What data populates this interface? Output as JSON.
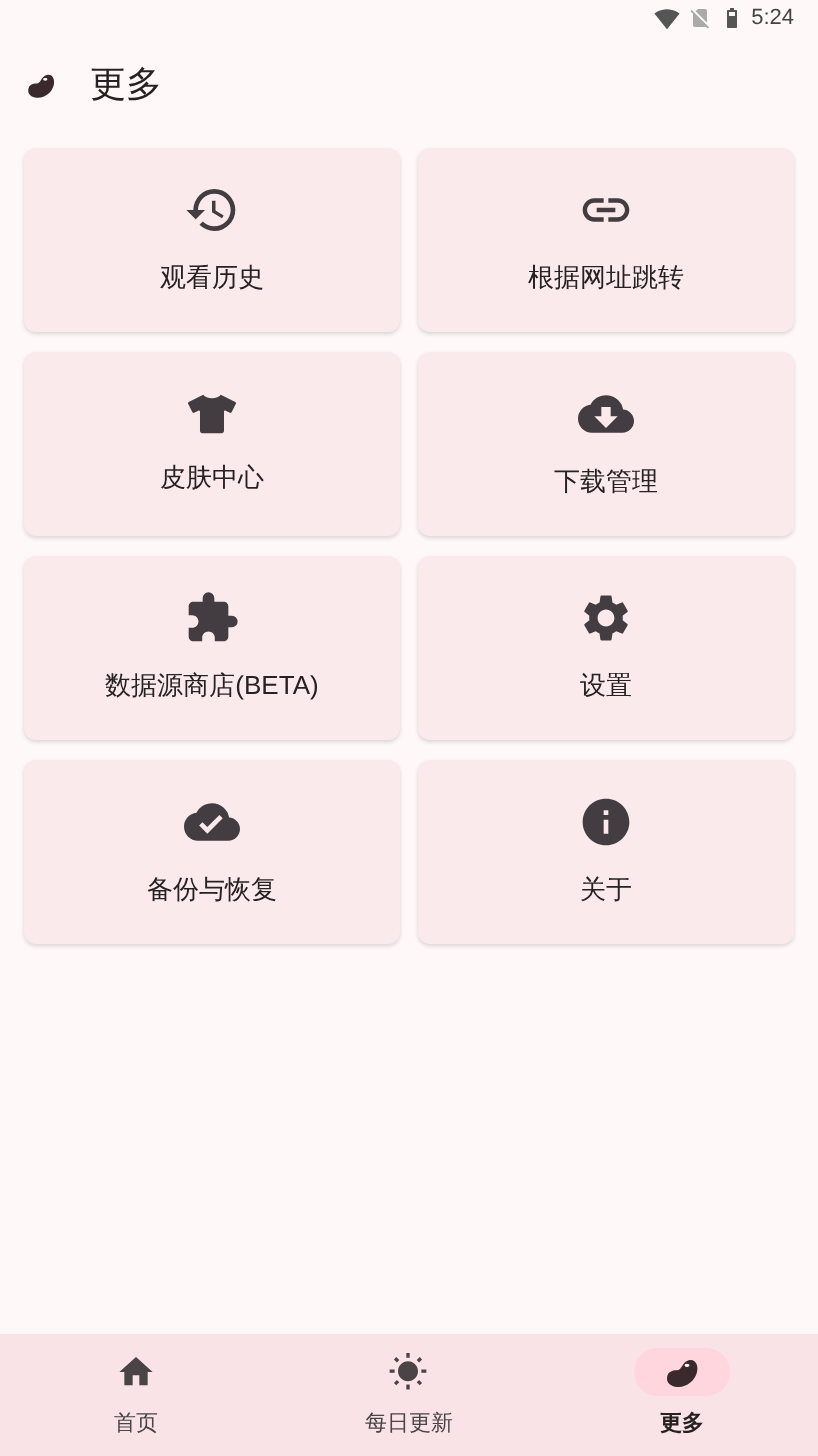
{
  "status_bar": {
    "time": "5:24"
  },
  "app_bar": {
    "title": "更多"
  },
  "menu_items": [
    {
      "label": "观看历史",
      "kind": "history"
    },
    {
      "label": "根据网址跳转",
      "kind": "link"
    },
    {
      "label": "皮肤中心",
      "kind": "shirt"
    },
    {
      "label": "下载管理",
      "kind": "download"
    },
    {
      "label": "数据源商店(BETA)",
      "kind": "extension"
    },
    {
      "label": "设置",
      "kind": "settings"
    },
    {
      "label": "备份与恢复",
      "kind": "backup"
    },
    {
      "label": "关于",
      "kind": "info"
    }
  ],
  "bottom_nav": [
    {
      "label": "首页",
      "kind": "home",
      "selected": false
    },
    {
      "label": "每日更新",
      "kind": "sun",
      "selected": false
    },
    {
      "label": "更多",
      "kind": "bean",
      "selected": true
    }
  ]
}
